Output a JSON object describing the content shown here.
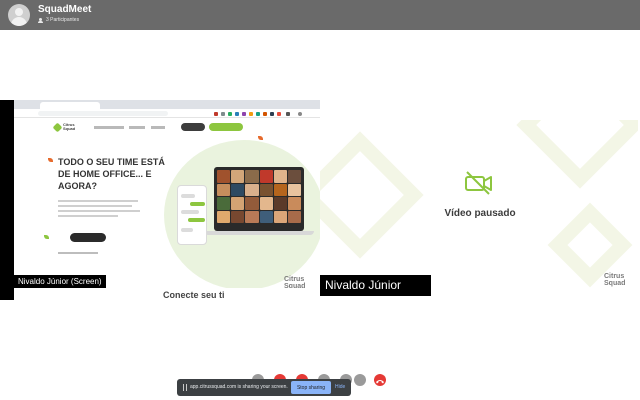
{
  "header": {
    "app_title": "SquadMeet",
    "participants": "3 Participantes"
  },
  "screen_tile": {
    "label": "Nivaldo Júnior (Screen)",
    "hero_heading": "TODO O SEU TIME ESTÁ DE HOME OFFICE... E AGORA?",
    "logo_text": "Citrus Squad",
    "bottom_strip_text": "Conecte seu ti",
    "watermark": "Citrus Squad"
  },
  "camera_tile": {
    "label": "Nivaldo Júnior",
    "status_text": "Vídeo pausado",
    "watermark": "Citrus Squad"
  },
  "screen_share_banner": {
    "message": "app.citrussquad.com is sharing your screen.",
    "stop_label": "Stop sharing",
    "hide_label": "Hide"
  },
  "colors": {
    "header_bg": "#6a6a6a",
    "accent_green": "#8dc63f",
    "hangup_red": "#e53935",
    "stop_sharing_blue": "#8ab4f8"
  },
  "icons": [
    "participants-icon",
    "video-off-icon",
    "pause-icon",
    "hang-up-icon",
    "camera-icon",
    "microphone-icon"
  ]
}
